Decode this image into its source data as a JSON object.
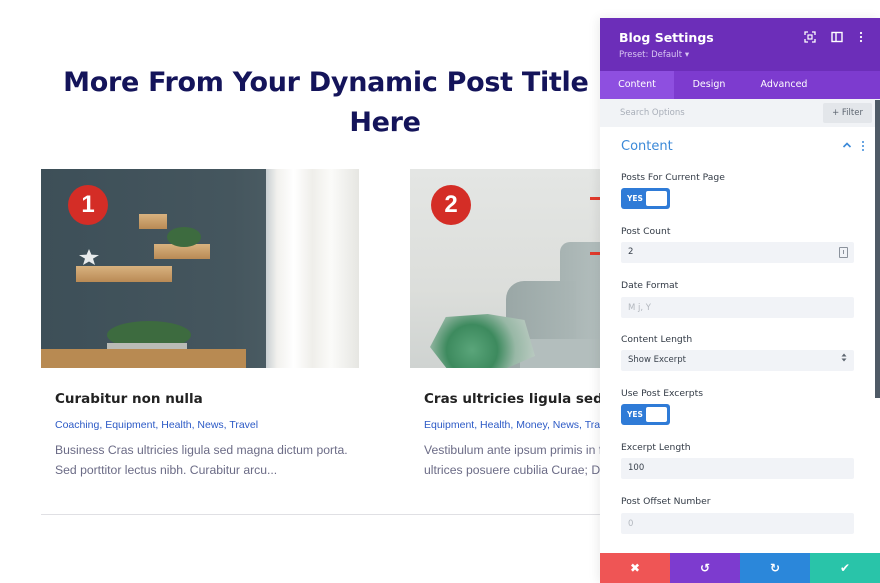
{
  "page": {
    "title": "More From Your Dynamic Post Title Display Here",
    "posts": [
      {
        "badge": "1",
        "title": "Curabitur non nulla",
        "categories": "Coaching, Equipment, Health, News, Travel",
        "excerpt_lines": [
          "Business Cras ultricies ligula sed magna dictum porta.",
          "Sed porttitor lectus nibh. Curabitur arcu..."
        ]
      },
      {
        "badge": "2",
        "title": "Cras ultricies ligula sed ma",
        "categories": "Equipment, Health, Money, News, Travel",
        "excerpt_lines": [
          "Vestibulum ante ipsum primis in fau",
          "ultrices posuere cubilia Curae; Done"
        ]
      }
    ]
  },
  "panel": {
    "title": "Blog Settings",
    "preset": "Preset: Default ▾",
    "header_icons": [
      "fullscreen-icon",
      "split-view-icon",
      "more-options-icon"
    ],
    "tabs": [
      {
        "label": "Content",
        "active": true
      },
      {
        "label": "Design",
        "active": false
      },
      {
        "label": "Advanced",
        "active": false
      }
    ],
    "search": {
      "placeholder": "Search Options",
      "value": ""
    },
    "filter_label": "+ Filter",
    "section": {
      "title": "Content",
      "expanded": true
    },
    "fields": {
      "posts_for_current_page": {
        "label": "Posts For Current Page",
        "toggle": "YES"
      },
      "post_count": {
        "label": "Post Count",
        "value": "2"
      },
      "date_format": {
        "label": "Date Format",
        "placeholder": "M j, Y",
        "value": ""
      },
      "content_length": {
        "label": "Content Length",
        "value": "Show Excerpt"
      },
      "use_post_excerpts": {
        "label": "Use Post Excerpts",
        "toggle": "YES"
      },
      "excerpt_length": {
        "label": "Excerpt Length",
        "value": "100"
      },
      "post_offset_number": {
        "label": "Post Offset Number",
        "placeholder": "0",
        "value": ""
      }
    },
    "footer": {
      "cancel": "✖",
      "undo": "↺",
      "redo": "↻",
      "save": "✔"
    },
    "colors": {
      "header": "#6c2eb9",
      "tabs": "#7d3bcf",
      "accent_blue": "#2f7bd7",
      "cancel": "#ef5555",
      "save": "#29c4a9",
      "annotation_arrow": "#e23a2c"
    }
  }
}
